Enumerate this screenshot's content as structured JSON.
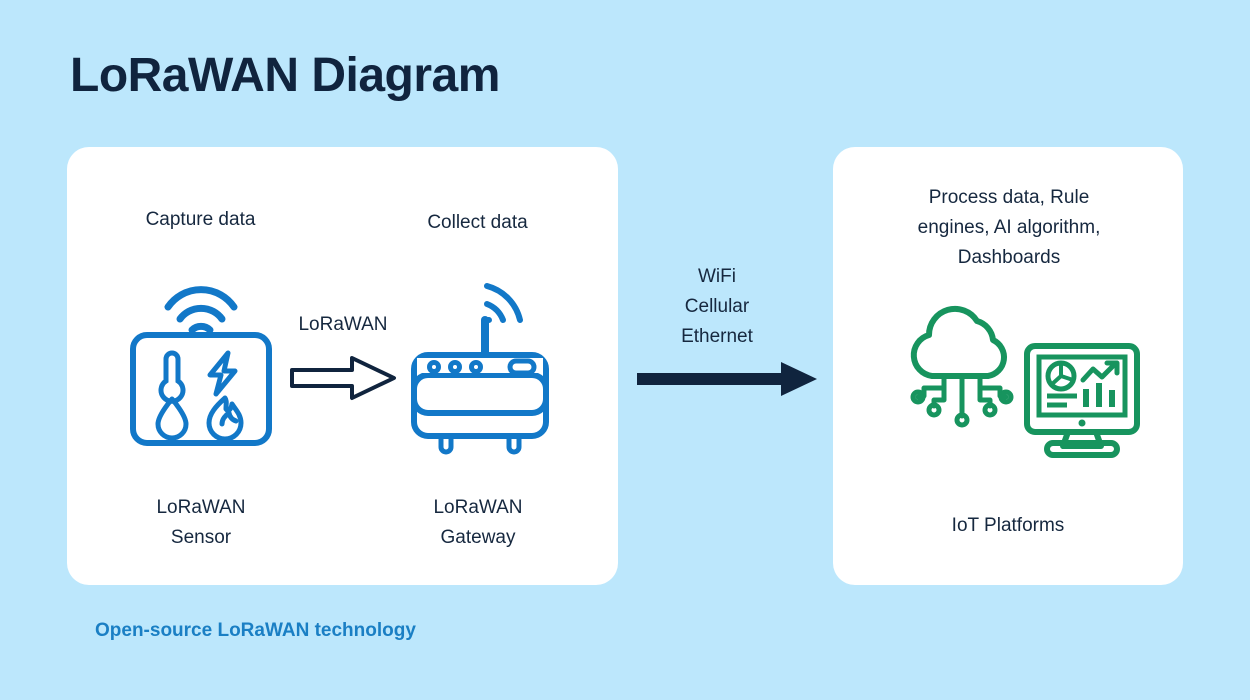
{
  "page": {
    "title": "LoRaWAN Diagram",
    "background_color": "#bce7fc",
    "text_color": "#16283f",
    "accent_blue": "#1278c8",
    "accent_green": "#17945e",
    "link_blue": "#1a7fc4",
    "card_color": "#ffffff"
  },
  "left_card": {
    "sensor": {
      "header": "Capture data",
      "icon": "lorawan-sensor-icon",
      "footer_line1": "LoRaWAN",
      "footer_line2": "Sensor",
      "sensor_glyphs": [
        "thermometer-icon",
        "lightning-bolt-icon",
        "water-drop-icon",
        "flame-icon"
      ]
    },
    "connection": {
      "label": "LoRaWAN",
      "arrow": "hollow-right-arrow-icon"
    },
    "gateway": {
      "header": "Collect data",
      "icon": "lorawan-gateway-icon",
      "footer_line1": "LoRaWAN",
      "footer_line2": "Gateway"
    }
  },
  "middle": {
    "link_types": [
      "WiFi",
      "Cellular",
      "Ethernet"
    ],
    "arrow": "solid-right-arrow-icon"
  },
  "right_card": {
    "header_line1": "Process data, Rule",
    "header_line2": "engines, AI algorithm,",
    "header_line3": "Dashboards",
    "icons": [
      "cloud-network-icon",
      "dashboard-monitor-icon"
    ],
    "footer": "IoT Platforms"
  },
  "footer": {
    "note": "Open-source LoRaWAN technology"
  }
}
